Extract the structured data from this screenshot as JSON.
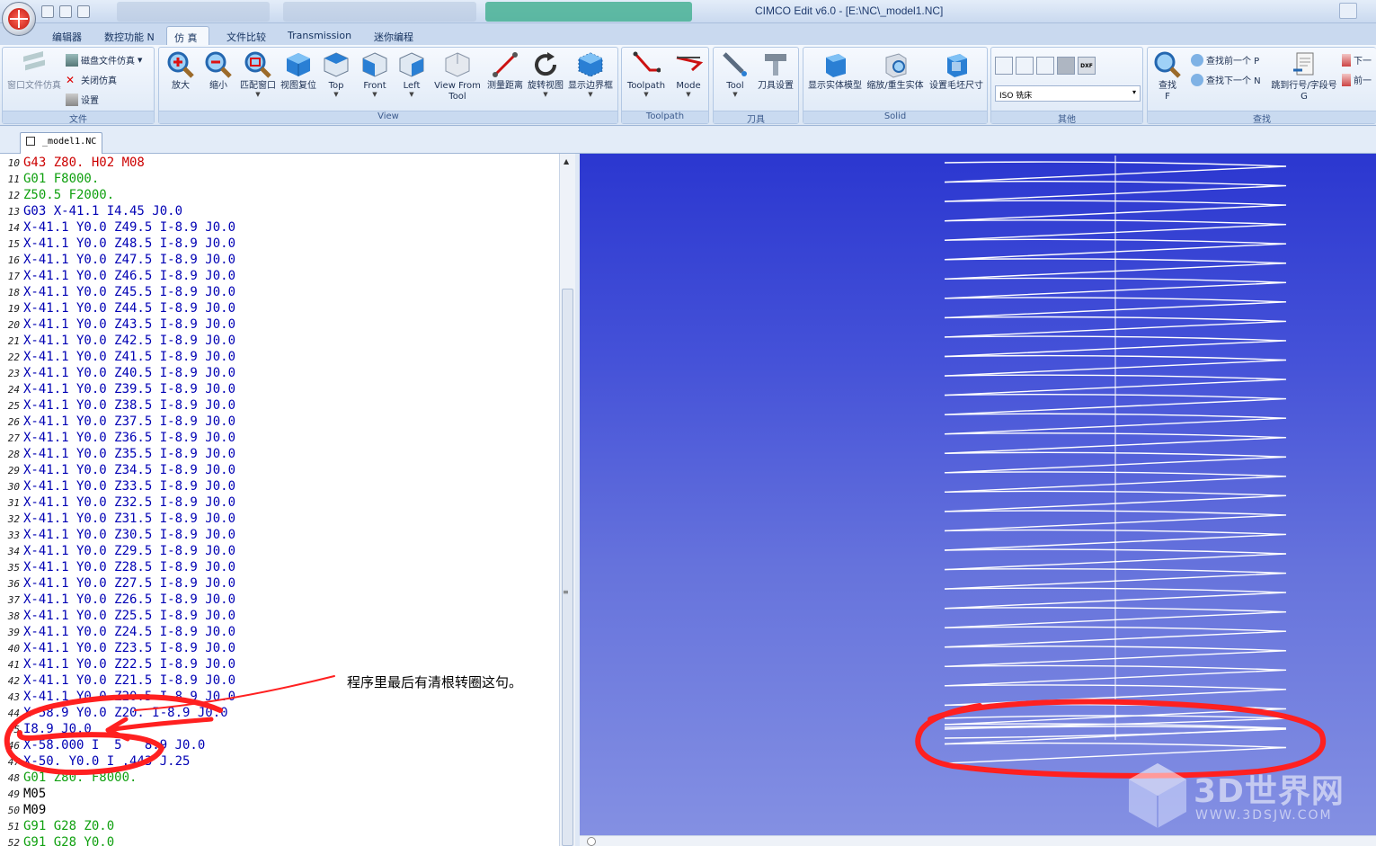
{
  "title": "CIMCO Edit v6.0 - [E:\\NC\\_model1.NC]",
  "ribbon_tabs": [
    "编辑器",
    "数控功能 N",
    "仿 真",
    "文件比较",
    "Transmission",
    "迷你编程"
  ],
  "active_tab": "仿 真",
  "groups": {
    "file": {
      "label": "文件",
      "big_label": "窗口文件仿真",
      "items": [
        "磁盘文件仿真",
        "关闭仿真",
        "设置"
      ]
    },
    "view": {
      "label": "View",
      "buttons": [
        "放大",
        "缩小",
        "匹配窗口",
        "视图复位",
        "Top",
        "Front",
        "Left",
        "View From Tool",
        "测量距离",
        "旋转视图",
        "显示边界框"
      ]
    },
    "toolpath": {
      "label": "Toolpath",
      "buttons": [
        "Toolpath",
        "Mode"
      ]
    },
    "tool": {
      "label": "刀具",
      "buttons": [
        "Tool",
        "刀具设置"
      ]
    },
    "solid": {
      "label": "Solid",
      "buttons": [
        "显示实体模型",
        "缩放/重生实体",
        "设置毛坯尺寸"
      ]
    },
    "other": {
      "label": "其他",
      "select_value": "ISO 铣床"
    },
    "find": {
      "label": "查找",
      "big_label": "查找",
      "big_sub": "F",
      "items": [
        "查找前一个 P",
        "查找下一个 N"
      ],
      "jump": "跳到行号/字段号",
      "jump_sub": "G",
      "next_items": [
        "下一",
        "前一"
      ]
    }
  },
  "document_tab": "_model1.NC",
  "code_lines": [
    {
      "n": "10",
      "t": "G43 Z80. H02 M08",
      "c": "red"
    },
    {
      "n": "11",
      "t": "G01 F8000.",
      "c": "green"
    },
    {
      "n": "12",
      "t": "Z50.5 F2000.",
      "c": "green"
    },
    {
      "n": "13",
      "t": "G03 X-41.1 I4.45 J0.0",
      "c": "blue"
    },
    {
      "n": "14",
      "t": "X-41.1 Y0.0 Z49.5 I-8.9 J0.0",
      "c": "blue"
    },
    {
      "n": "15",
      "t": "X-41.1 Y0.0 Z48.5 I-8.9 J0.0",
      "c": "blue"
    },
    {
      "n": "16",
      "t": "X-41.1 Y0.0 Z47.5 I-8.9 J0.0",
      "c": "blue"
    },
    {
      "n": "17",
      "t": "X-41.1 Y0.0 Z46.5 I-8.9 J0.0",
      "c": "blue"
    },
    {
      "n": "18",
      "t": "X-41.1 Y0.0 Z45.5 I-8.9 J0.0",
      "c": "blue"
    },
    {
      "n": "19",
      "t": "X-41.1 Y0.0 Z44.5 I-8.9 J0.0",
      "c": "blue"
    },
    {
      "n": "20",
      "t": "X-41.1 Y0.0 Z43.5 I-8.9 J0.0",
      "c": "blue"
    },
    {
      "n": "21",
      "t": "X-41.1 Y0.0 Z42.5 I-8.9 J0.0",
      "c": "blue"
    },
    {
      "n": "22",
      "t": "X-41.1 Y0.0 Z41.5 I-8.9 J0.0",
      "c": "blue"
    },
    {
      "n": "23",
      "t": "X-41.1 Y0.0 Z40.5 I-8.9 J0.0",
      "c": "blue"
    },
    {
      "n": "24",
      "t": "X-41.1 Y0.0 Z39.5 I-8.9 J0.0",
      "c": "blue"
    },
    {
      "n": "25",
      "t": "X-41.1 Y0.0 Z38.5 I-8.9 J0.0",
      "c": "blue"
    },
    {
      "n": "26",
      "t": "X-41.1 Y0.0 Z37.5 I-8.9 J0.0",
      "c": "blue"
    },
    {
      "n": "27",
      "t": "X-41.1 Y0.0 Z36.5 I-8.9 J0.0",
      "c": "blue"
    },
    {
      "n": "28",
      "t": "X-41.1 Y0.0 Z35.5 I-8.9 J0.0",
      "c": "blue"
    },
    {
      "n": "29",
      "t": "X-41.1 Y0.0 Z34.5 I-8.9 J0.0",
      "c": "blue"
    },
    {
      "n": "30",
      "t": "X-41.1 Y0.0 Z33.5 I-8.9 J0.0",
      "c": "blue"
    },
    {
      "n": "31",
      "t": "X-41.1 Y0.0 Z32.5 I-8.9 J0.0",
      "c": "blue"
    },
    {
      "n": "32",
      "t": "X-41.1 Y0.0 Z31.5 I-8.9 J0.0",
      "c": "blue"
    },
    {
      "n": "33",
      "t": "X-41.1 Y0.0 Z30.5 I-8.9 J0.0",
      "c": "blue"
    },
    {
      "n": "34",
      "t": "X-41.1 Y0.0 Z29.5 I-8.9 J0.0",
      "c": "blue"
    },
    {
      "n": "35",
      "t": "X-41.1 Y0.0 Z28.5 I-8.9 J0.0",
      "c": "blue"
    },
    {
      "n": "36",
      "t": "X-41.1 Y0.0 Z27.5 I-8.9 J0.0",
      "c": "blue"
    },
    {
      "n": "37",
      "t": "X-41.1 Y0.0 Z26.5 I-8.9 J0.0",
      "c": "blue"
    },
    {
      "n": "38",
      "t": "X-41.1 Y0.0 Z25.5 I-8.9 J0.0",
      "c": "blue"
    },
    {
      "n": "39",
      "t": "X-41.1 Y0.0 Z24.5 I-8.9 J0.0",
      "c": "blue"
    },
    {
      "n": "40",
      "t": "X-41.1 Y0.0 Z23.5 I-8.9 J0.0",
      "c": "blue"
    },
    {
      "n": "41",
      "t": "X-41.1 Y0.0 Z22.5 I-8.9 J0.0",
      "c": "blue"
    },
    {
      "n": "42",
      "t": "X-41.1 Y0.0 Z21.5 I-8.9 J0.0",
      "c": "blue"
    },
    {
      "n": "43",
      "t": "X-41.1 Y0.0 Z20.5 I-8.9 J0.0",
      "c": "blue"
    },
    {
      "n": "44",
      "t": "X-58.9 Y0.0 Z20. I-8.9 J0.0",
      "c": "blue"
    },
    {
      "n": "45",
      "t": "I8.9 J0.0",
      "c": "blue"
    },
    {
      "n": "46",
      "t": "X-58.000 I  5   8.9 J0.0",
      "c": "blue"
    },
    {
      "n": "47",
      "t": "X-50. Y0.0 I .443 J.25",
      "c": "blue"
    },
    {
      "n": "48",
      "t": "G01 Z80. F8000.",
      "c": "green"
    },
    {
      "n": "49",
      "t": "M05",
      "c": "black"
    },
    {
      "n": "50",
      "t": "M09",
      "c": "black"
    },
    {
      "n": "51",
      "t": "G91 G28 Z0.0",
      "c": "green"
    },
    {
      "n": "52",
      "t": "G91 G28 Y0.0",
      "c": "green"
    }
  ],
  "annotation": "程序里最后有清根转圈这句。",
  "watermark": {
    "brand": "3D世界网",
    "url": "WWW.3DSJW.COM"
  },
  "colors": {
    "code_red": "#cc0000",
    "code_green": "#10a010",
    "code_blue": "#0000b4",
    "annotation_stroke": "#ff2020",
    "toolpath": "#ffffff"
  }
}
